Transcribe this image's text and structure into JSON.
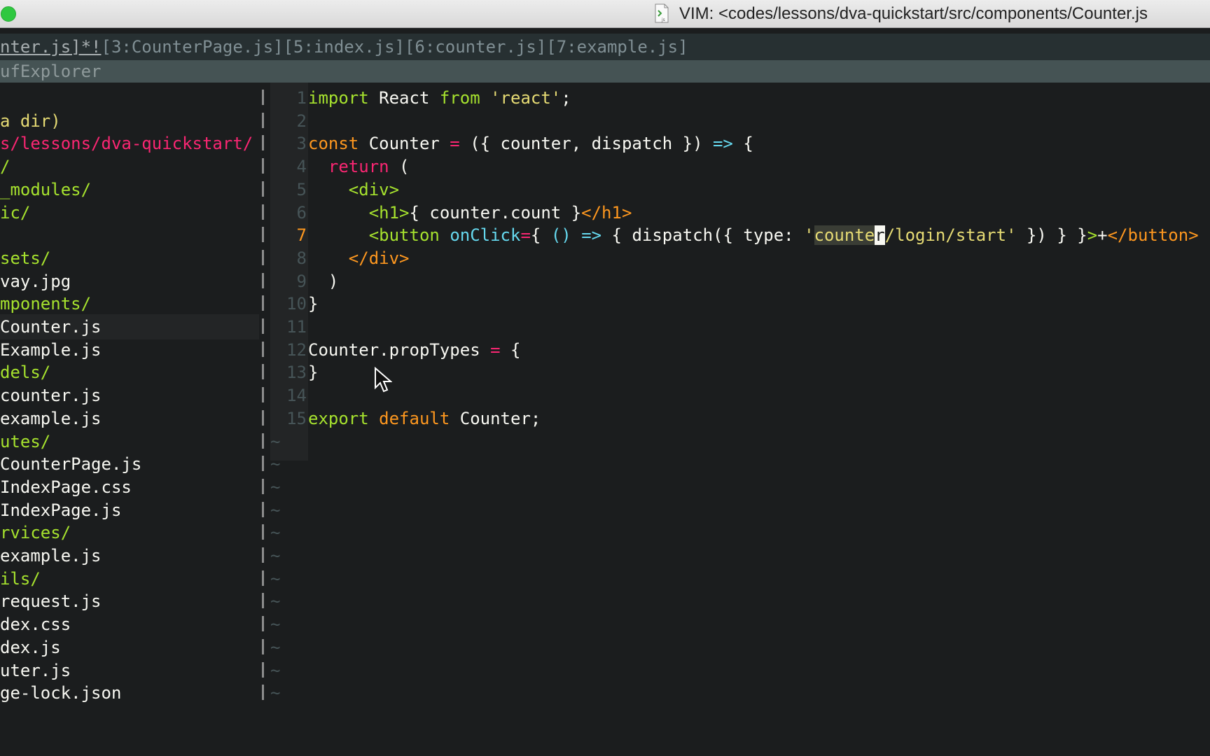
{
  "window": {
    "title": "VIM: <codes/lessons/dva-quickstart/src/components/Counter.js"
  },
  "tabline": {
    "active": "nter.js]*!",
    "tabs": [
      "[3:CounterPage.js]",
      "[5:index.js]",
      "[6:counter.js]",
      "[7:example.js]"
    ]
  },
  "bufexplorer": {
    "title": "ufExplorer"
  },
  "explorer": {
    "items": [
      {
        "text": "",
        "kind": "file"
      },
      {
        "text": " a dir)",
        "kind": "yellow"
      },
      {
        "text": "s/lessons/dva-quickstart/",
        "kind": "root"
      },
      {
        "text": "/",
        "kind": "dir"
      },
      {
        "text": "_modules/",
        "kind": "dir"
      },
      {
        "text": "ic/",
        "kind": "dir"
      },
      {
        "text": "",
        "kind": "file"
      },
      {
        "text": "sets/",
        "kind": "dir"
      },
      {
        "text": "vay.jpg",
        "kind": "file"
      },
      {
        "text": "mponents/",
        "kind": "dir"
      },
      {
        "text": "Counter.js",
        "kind": "file",
        "selected": true
      },
      {
        "text": "Example.js",
        "kind": "file"
      },
      {
        "text": "dels/",
        "kind": "dir"
      },
      {
        "text": "counter.js",
        "kind": "file"
      },
      {
        "text": "example.js",
        "kind": "file"
      },
      {
        "text": "utes/",
        "kind": "dir"
      },
      {
        "text": "CounterPage.js",
        "kind": "file"
      },
      {
        "text": "IndexPage.css",
        "kind": "file"
      },
      {
        "text": "IndexPage.js",
        "kind": "file"
      },
      {
        "text": "rvices/",
        "kind": "dir"
      },
      {
        "text": "example.js",
        "kind": "file"
      },
      {
        "text": "ils/",
        "kind": "dir"
      },
      {
        "text": "request.js",
        "kind": "file"
      },
      {
        "text": "dex.css",
        "kind": "file"
      },
      {
        "text": "dex.js",
        "kind": "file"
      },
      {
        "text": "uter.js",
        "kind": "file"
      },
      {
        "text": "ge-lock.json",
        "kind": "file"
      }
    ]
  },
  "editor": {
    "current_line": 7,
    "lines": [
      {
        "num": "1",
        "tokens": [
          [
            "import",
            "k-green"
          ],
          [
            " React ",
            "k-white"
          ],
          [
            "from",
            "k-green"
          ],
          [
            " ",
            "k-white"
          ],
          [
            "'react'",
            "k-yellow"
          ],
          [
            ";",
            "k-white"
          ]
        ]
      },
      {
        "num": "2",
        "tokens": []
      },
      {
        "num": "3",
        "tokens": [
          [
            "const",
            "k-orange"
          ],
          [
            " Counter ",
            "k-white"
          ],
          [
            "=",
            "k-pink"
          ],
          [
            " ({ counter, dispatch }) ",
            "k-white"
          ],
          [
            "=>",
            "k-cyan"
          ],
          [
            " {",
            "k-white"
          ]
        ]
      },
      {
        "num": "4",
        "tokens": [
          [
            "  ",
            "k-white"
          ],
          [
            "return",
            "k-pink"
          ],
          [
            " (",
            "k-white"
          ]
        ]
      },
      {
        "num": "5",
        "tokens": [
          [
            "    ",
            "k-white"
          ],
          [
            "<div>",
            "k-green"
          ]
        ]
      },
      {
        "num": "6",
        "tokens": [
          [
            "      ",
            "k-white"
          ],
          [
            "<h1>",
            "k-green"
          ],
          [
            "{ counter.count }",
            "k-white"
          ],
          [
            "</h1>",
            "k-orange"
          ]
        ]
      },
      {
        "num": "7",
        "tokens": [
          [
            "      ",
            "k-white"
          ],
          [
            "<button",
            "k-green"
          ],
          [
            " ",
            "k-white"
          ],
          [
            "onClick",
            "k-cyan"
          ],
          [
            "=",
            "k-pink"
          ],
          [
            "{ ",
            "k-white"
          ],
          [
            "()",
            "k-cyan"
          ],
          [
            " ",
            "k-white"
          ],
          [
            "=>",
            "k-cyan"
          ],
          [
            " { dispatch({ type: ",
            "k-white"
          ],
          [
            "'",
            "k-yellow"
          ],
          [
            "counte",
            "hl"
          ],
          [
            "r",
            "cursor"
          ],
          [
            "/login/start'",
            "k-yellow"
          ],
          [
            " }) } }",
            "k-white"
          ],
          [
            ">",
            "k-green"
          ],
          [
            "+",
            "k-white"
          ],
          [
            "</button>",
            "k-orange"
          ]
        ]
      },
      {
        "num": "8",
        "tokens": [
          [
            "    ",
            "k-white"
          ],
          [
            "</div>",
            "k-orange"
          ]
        ]
      },
      {
        "num": "9",
        "tokens": [
          [
            "  )",
            "k-white"
          ]
        ]
      },
      {
        "num": "10",
        "tokens": [
          [
            "}",
            "k-white"
          ]
        ]
      },
      {
        "num": "11",
        "tokens": []
      },
      {
        "num": "12",
        "tokens": [
          [
            "Counter.propTypes ",
            "k-white"
          ],
          [
            "=",
            "k-pink"
          ],
          [
            " {",
            "k-white"
          ]
        ]
      },
      {
        "num": "13",
        "tokens": [
          [
            "}",
            "k-white"
          ]
        ]
      },
      {
        "num": "14",
        "tokens": []
      },
      {
        "num": "15",
        "tokens": [
          [
            "export",
            "k-green"
          ],
          [
            " ",
            "k-white"
          ],
          [
            "default",
            "k-orange"
          ],
          [
            " Counter;",
            "k-white"
          ]
        ]
      }
    ],
    "tilde_char": "~",
    "tilde_count": 12
  },
  "colors": {
    "background": "#1b1d1e",
    "dir": "#a6e22e",
    "root": "#f92672",
    "current_line_number": "#fd971f"
  }
}
